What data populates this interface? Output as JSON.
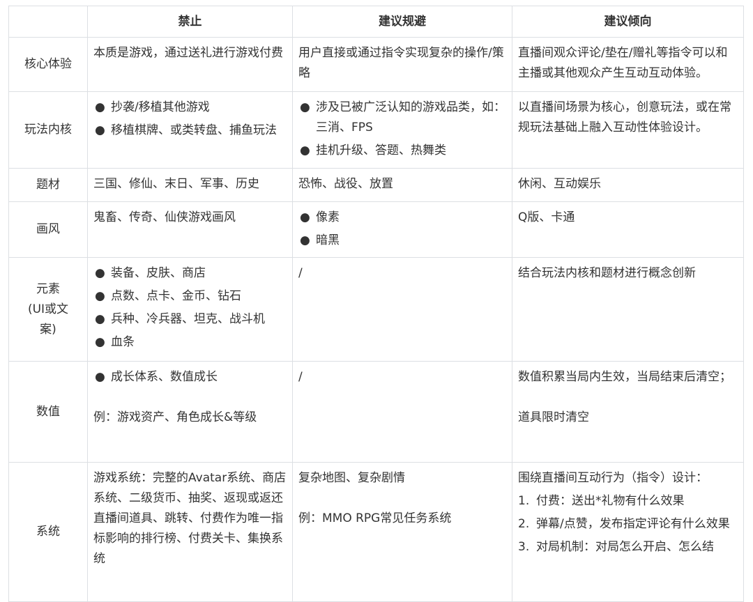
{
  "headers": [
    "",
    "禁止",
    "建议规避",
    "建议倾向"
  ],
  "rows": [
    {
      "label": "核心体验",
      "forbidden_text": "本质是游戏，通过送礼进行游戏付费",
      "avoid_text": "用户直接或通过指令实现复杂的操作/策略",
      "prefer_text": "直播间观众评论/垫在/赠礼等指令可以和主播或其他观众产生互动互动体验。"
    },
    {
      "label": "玩法内核",
      "forbidden_items": [
        "抄袭/移植其他游戏",
        "移植棋牌、或类转盘、捕鱼玩法"
      ],
      "avoid_items": [
        "涉及已被广泛认知的游戏品类，如：三消、FPS",
        "挂机升级、答题、热舞类"
      ],
      "prefer_text": "以直播间场景为核心，创意玩法，或在常规玩法基础上融入互动性体验设计。"
    },
    {
      "label": "题材",
      "forbidden_text": "三国、修仙、末日、军事、历史",
      "avoid_text": "恐怖、战役、放置",
      "prefer_text": "休闲、互动娱乐"
    },
    {
      "label": "画风",
      "forbidden_text": "鬼畜、传奇、仙侠游戏画风",
      "avoid_items": [
        "像素",
        "暗黑"
      ],
      "prefer_text": "Q版、卡通"
    },
    {
      "label": "元素\n(UI或文案)",
      "label_line1": "元素",
      "label_line2": "(UI或文",
      "label_line3": "案)",
      "forbidden_items": [
        "装备、皮肤、商店",
        "点数、点卡、金币、钻石",
        "兵种、冷兵器、坦克、战斗机",
        "血条"
      ],
      "avoid_text": "/",
      "prefer_text": "结合玩法内核和题材进行概念创新"
    },
    {
      "label": "数值",
      "forbidden_items": [
        "成长体系、数值成长"
      ],
      "forbidden_example": "例：游戏资产、角色成长&等级",
      "avoid_text": "/",
      "prefer_text": "数值积累当局内生效，当局结束后清空；",
      "prefer_text2": "道具限时清空"
    },
    {
      "label": "系统",
      "forbidden_text": "游戏系统：完整的Avatar系统、商店系统、二级货币、抽奖、返现或返还直播间道具、跳转、付费作为唯一指标影响的排行榜、付费关卡、集换系统",
      "avoid_text": "复杂地图、复杂剧情",
      "avoid_example": "例：MMO RPG常见任务系统",
      "prefer_intro": "围绕直播间互动行为（指令）设计：",
      "prefer_list": [
        {
          "num": "1.",
          "text": "付费：送出*礼物有什么效果"
        },
        {
          "num": "2.",
          "text": "弹幕/点赞，发布指定评论有什么效果"
        },
        {
          "num": "3.",
          "text": "对局机制：对局怎么开启、怎么结"
        }
      ]
    }
  ],
  "bullet_glyph": "●",
  "colors": {
    "border": "#dcdfe3",
    "text": "#333333",
    "background": "#ffffff"
  }
}
